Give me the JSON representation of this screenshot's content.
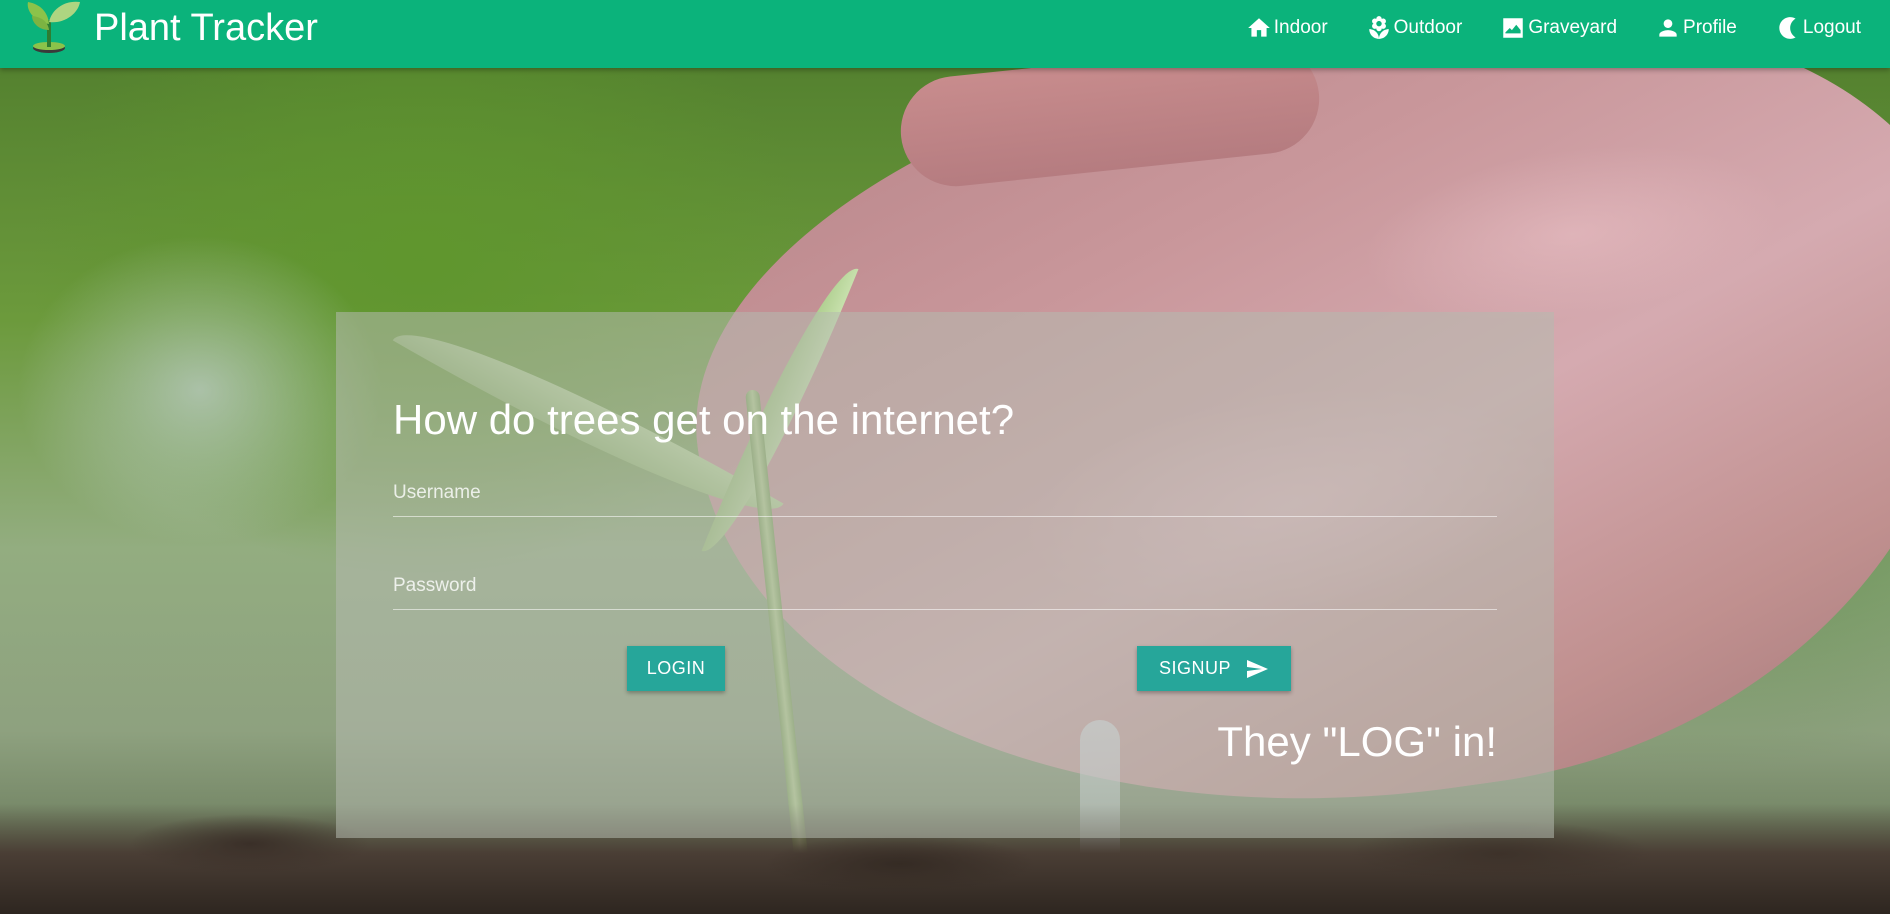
{
  "brand": {
    "title": "Plant Tracker",
    "logo_icon": "seedling-pot-icon"
  },
  "nav": {
    "items": [
      {
        "label": "Indoor",
        "icon": "home-icon"
      },
      {
        "label": "Outdoor",
        "icon": "flower-icon"
      },
      {
        "label": "Graveyard",
        "icon": "landscape-icon"
      },
      {
        "label": "Profile",
        "icon": "person-icon"
      },
      {
        "label": "Logout",
        "icon": "moon-icon"
      }
    ]
  },
  "login": {
    "question": "How do trees get on the internet?",
    "username_placeholder": "Username",
    "username_value": "",
    "password_placeholder": "Password",
    "password_value": "",
    "login_label": "LOGIN",
    "signup_label": "SIGNUP",
    "signup_icon": "send-icon",
    "answer": "They \"LOG\" in!"
  },
  "colors": {
    "navbar": "#0bb37b",
    "button": "#26a69a",
    "text": "#ffffff"
  }
}
